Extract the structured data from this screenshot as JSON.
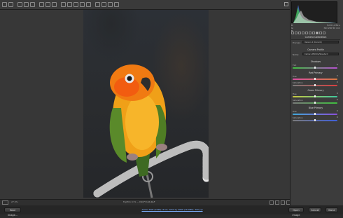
{
  "toolbar": {
    "tools": [
      "zoom-icon",
      "hand-icon",
      "white-balance-icon",
      "color-sampler-icon",
      "target-adjust-icon",
      "crop-icon",
      "straighten-icon",
      "transform-icon",
      "spot-removal-icon",
      "red-eye-icon",
      "adjustment-brush-icon",
      "graduated-filter-icon",
      "radial-filter-icon",
      "preferences-icon",
      "rotate-left-icon",
      "rotate-right-icon",
      "trash-icon"
    ],
    "fullscreen_icon": "fullscreen-icon"
  },
  "status": {
    "zoom_level": "27.5%",
    "filename": "Fujifilm X-T1 — DSCF3146.RAF",
    "view_icons": [
      "before-after-icon",
      "swap-icon",
      "copy-icon",
      "toggle-icon"
    ]
  },
  "footer": {
    "save_label": "Save Image...",
    "workflow_link": "Adobe RGB (1998); 8 bit; 3264 by 4896 (16.0MP); 300 ppi",
    "open_label": "Open Image",
    "cancel_label": "Cancel",
    "done_label": "Done"
  },
  "panel": {
    "camera_info": [
      {
        "label": "R:",
        "value": "f/2.8 1/250 s"
      },
      {
        "label": "G:",
        "value": "ISO 200 50 mm"
      },
      {
        "label": "B:",
        "value": ""
      }
    ],
    "section_title": "Camera Calibration",
    "process_label": "Process:",
    "process_value": "Version 4 (Current)",
    "profile_section": "Camera Profile",
    "name_label": "Name:",
    "name_value": "Camera PROVIA/Standard",
    "shadows_title": "Shadows",
    "tint_label": "Tint",
    "tint_value": "0",
    "red_title": "Red Primary",
    "red_hue_label": "Hue",
    "red_hue_value": "0",
    "red_sat_label": "Saturation",
    "red_sat_value": "0",
    "green_title": "Green Primary",
    "green_hue_label": "Hue",
    "green_hue_value": "0",
    "green_sat_label": "Saturation",
    "green_sat_value": "0",
    "blue_title": "Blue Primary",
    "blue_hue_label": "Hue",
    "blue_hue_value": "0",
    "blue_sat_label": "Saturation",
    "blue_sat_value": "0"
  },
  "colors": {
    "accent_link": "#7fb0ff",
    "panel_bg": "#3c3c3c"
  }
}
